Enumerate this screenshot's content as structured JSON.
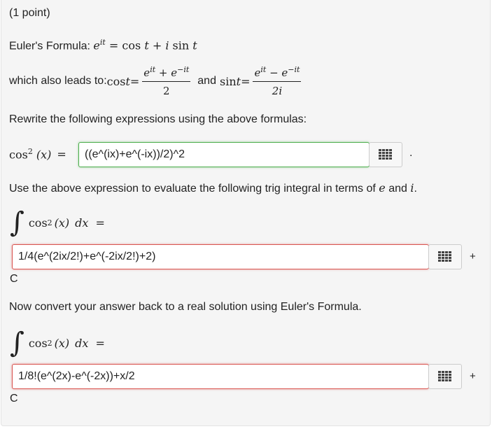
{
  "header": {
    "points": "(1 point)"
  },
  "euler": {
    "intro": "Euler's Formula: ",
    "lhs_base": "e",
    "lhs_exp": "it",
    "eq": " = ",
    "rhs_cos": "cos",
    "rhs_t1": " t",
    "rhs_plus": " + ",
    "rhs_i": "i",
    "rhs_sin": " sin",
    "rhs_t2": " t"
  },
  "leads": {
    "text": "which also leads to: ",
    "cos_label": "cos",
    "t": " t",
    "eq": " = ",
    "cos_num": "e^{it} + e^{-it}",
    "cos_num_parts": [
      "e",
      "it",
      " + e",
      "−it"
    ],
    "cos_den": "2",
    "and": "and",
    "sin_label": "sin",
    "sin_num_parts": [
      "e",
      "it",
      " − e",
      "−it"
    ],
    "sin_den": "2i"
  },
  "rewrite": {
    "text": "Rewrite the following expressions using the above formulas:"
  },
  "q1": {
    "lhs_fn": "cos",
    "lhs_pow": "2",
    "lhs_arg": "(x)",
    "eq": "=",
    "answer": "((e^(ix)+e^(-ix))/2)^2",
    "trailing": "."
  },
  "use": {
    "text": "Use the above expression to evaluate the following trig integral in terms of ",
    "e": "e",
    "and": " and ",
    "i": "i",
    "period": "."
  },
  "q2": {
    "integrand_fn": "cos",
    "pow": "2",
    "arg": "(x)",
    "dx": "dx",
    "eq": "=",
    "answer": "1/4(e^(2ix/2!)+e^(-2ix/2!)+2)",
    "plus": "+",
    "const": "C"
  },
  "convert": {
    "text": "Now convert your answer back to a real solution using Euler's Formula."
  },
  "q3": {
    "integrand_fn": "cos",
    "pow": "2",
    "arg": "(x)",
    "dx": "dx",
    "eq": "=",
    "answer": "1/8!(e^(2x)-e^(-2x))+x/2",
    "plus": "+",
    "const": "C"
  },
  "colors": {
    "correct_border": "#4cae4c",
    "incorrect_border": "#d9534f",
    "panel_bg": "#f5f5f5"
  },
  "icons": {
    "equation_palette": "grid-icon"
  }
}
